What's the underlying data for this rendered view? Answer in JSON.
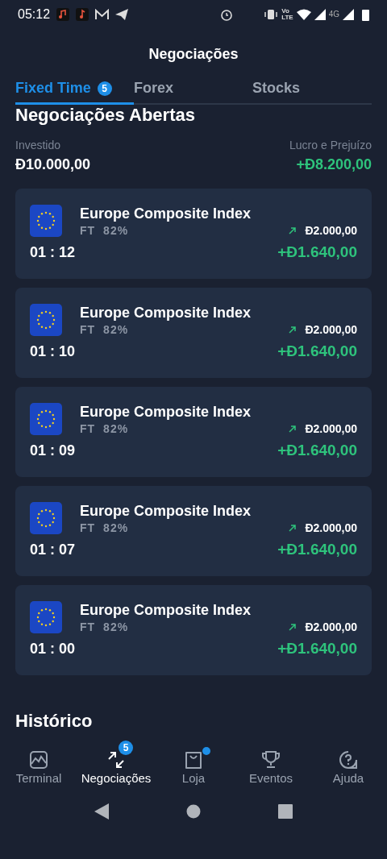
{
  "status_bar": {
    "time": "05:12",
    "network_labels": [
      "Vo",
      "LTE",
      "4G"
    ]
  },
  "header": {
    "title": "Negociações"
  },
  "tabs": [
    {
      "label": "Fixed Time",
      "badge": "5",
      "selected": true
    },
    {
      "label": "Forex",
      "selected": false
    },
    {
      "label": "Stocks",
      "selected": false
    }
  ],
  "section_title": "Negociações Abertas",
  "summary": {
    "invested_label": "Investido",
    "invested_value": "Đ10.000,00",
    "pnl_label": "Lucro e Prejuízo",
    "pnl_value": "+Đ8.200,00"
  },
  "trades": [
    {
      "name": "Europe Composite Index",
      "type": "FT",
      "payout": "82%",
      "time": "01 : 12",
      "kind": "up",
      "amount": "Đ2.000,00",
      "profit": "+Đ1.640,00"
    },
    {
      "name": "Europe Composite Index",
      "type": "FT",
      "payout": "82%",
      "time": "01 : 10",
      "kind": "up",
      "amount": "Đ2.000,00",
      "profit": "+Đ1.640,00"
    },
    {
      "name": "Europe Composite Index",
      "type": "FT",
      "payout": "82%",
      "time": "01 : 09",
      "kind": "up",
      "amount": "Đ2.000,00",
      "profit": "+Đ1.640,00"
    },
    {
      "name": "Europe Composite Index",
      "type": "FT",
      "payout": "82%",
      "time": "01 : 07",
      "kind": "up",
      "amount": "Đ2.000,00",
      "profit": "+Đ1.640,00"
    },
    {
      "name": "Europe Composite Index",
      "type": "FT",
      "payout": "82%",
      "time": "01 : 00",
      "kind": "up",
      "amount": "Đ2.000,00",
      "profit": "+Đ1.640,00"
    }
  ],
  "history_title": "Histórico",
  "bottom_nav": [
    {
      "label": "Terminal",
      "kind": "chart",
      "selected": false
    },
    {
      "label": "Negociações",
      "kind": "trades",
      "badge": "5",
      "selected": true
    },
    {
      "label": "Loja",
      "kind": "shop",
      "dot": true,
      "selected": false
    },
    {
      "label": "Eventos",
      "kind": "trophy",
      "selected": false
    },
    {
      "label": "Ajuda",
      "kind": "help",
      "selected": false
    }
  ]
}
